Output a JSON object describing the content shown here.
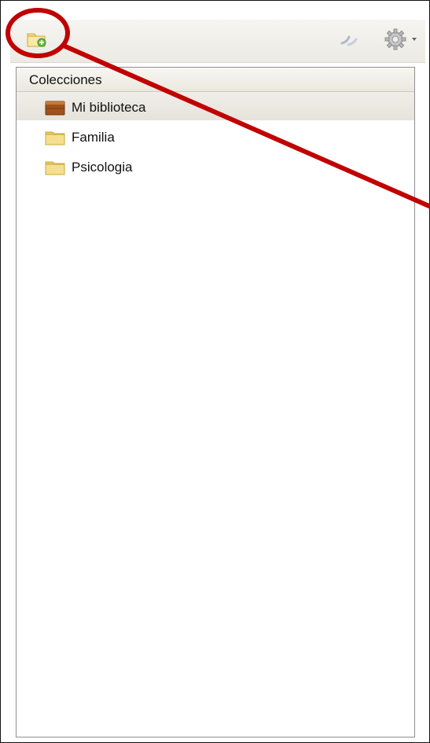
{
  "collections_panel": {
    "header": "Colecciones",
    "items": [
      {
        "label": "Mi biblioteca",
        "icon": "library-icon",
        "selected": true
      },
      {
        "label": "Familia",
        "icon": "folder-icon",
        "selected": false
      },
      {
        "label": "Psicologia",
        "icon": "folder-icon",
        "selected": false
      }
    ]
  },
  "toolbar": {
    "icons": [
      "new-collection-icon",
      "sync-icon",
      "gear-icon",
      "dropdown-arrow-icon"
    ]
  },
  "colors": {
    "annotation_red": "#c10000",
    "folder_yellow": "#f0d070",
    "library_brown": "#a0521c"
  }
}
